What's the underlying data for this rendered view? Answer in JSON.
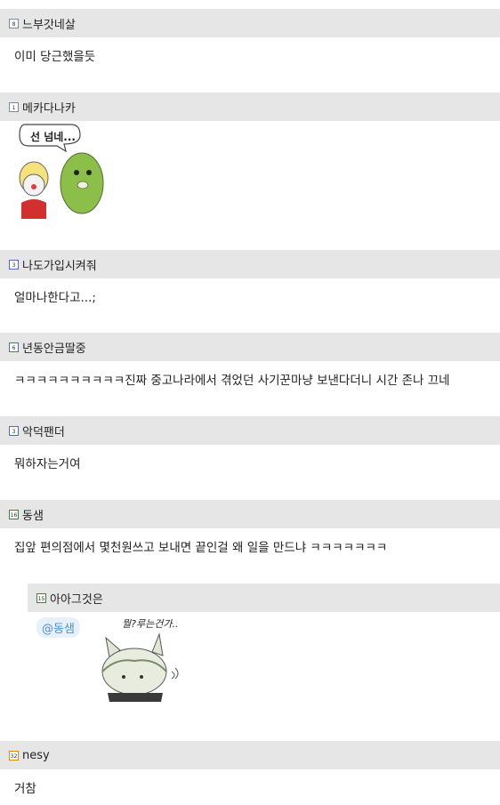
{
  "comments": [
    {
      "level": "8",
      "nick": "느부갓네살",
      "text": "이미 당근했을듯"
    },
    {
      "level": "1",
      "nick": "메카다나카",
      "sticker_text": "선 넘네..."
    },
    {
      "level": "3",
      "nick": "나도가입시켜줘",
      "text": "얼마나한다고...;"
    },
    {
      "level": "6",
      "nick": "년동안금딸중",
      "text": "ㅋㅋㅋㅋㅋㅋㅋㅋㅋㅋ진짜 중고나라에서 겪었던 사기꾼마냥 보낸다더니 시간 존나 끄네"
    },
    {
      "level": "3",
      "nick": "악덕팬더",
      "text": "뭐하자는거여"
    },
    {
      "level": "16",
      "nick": "동샘",
      "text": "집앞 편의점에서 몇천원쓰고 보내면 끝인걸 왜 일을 만드냐 ㅋㅋㅋㅋㅋㅋㅋ"
    },
    {
      "level": "15",
      "nick": "아아그것은",
      "mention": "@동샘",
      "sticker_text": "뭘?루는건가.."
    },
    {
      "level": "32",
      "nick": "nesy",
      "text": "거참"
    }
  ],
  "colors": {
    "header_bg": "#e6e6e6",
    "mention": "#4a90d9"
  }
}
